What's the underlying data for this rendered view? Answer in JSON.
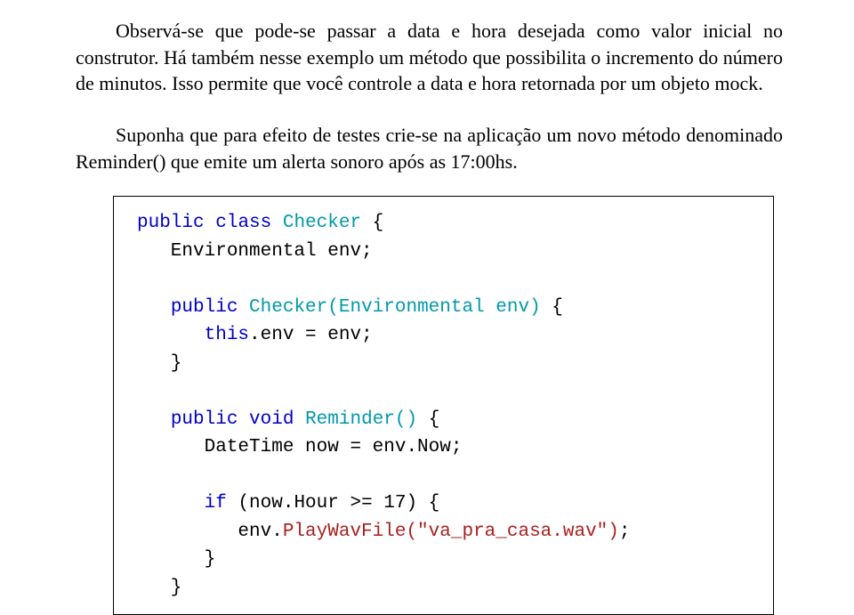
{
  "paragraphs": {
    "p1": "Observá-se que pode-se passar a data e hora desejada como valor inicial no construtor. Há também nesse exemplo um método que possibilita o incremento do número de minutos. Isso permite que você controle a data e hora retornada por um objeto mock.",
    "p2": "Suponha que para efeito de testes crie-se na aplicação um novo método denominado Reminder() que emite um alerta sonoro após as 17:00hs."
  },
  "code": {
    "line1_a": "public",
    "line1_b": " ",
    "line1_c": "class",
    "line1_d": " ",
    "line1_e": "Checker",
    "line1_f": " {",
    "line2": "   Environmental env;",
    "line3_a": "   ",
    "line3_b": "public",
    "line3_c": " ",
    "line3_d": "Checker(Environmental env)",
    "line3_e": " {",
    "line4_a": "      ",
    "line4_b": "this",
    "line4_c": ".env = env;",
    "line5": "   }",
    "line6_a": "   ",
    "line6_b": "public",
    "line6_c": " ",
    "line6_d": "void",
    "line6_e": " ",
    "line6_f": "Reminder()",
    "line6_g": " {",
    "line7": "      DateTime now = env.Now;",
    "line8_a": "      ",
    "line8_b": "if",
    "line8_c": " (now.Hour >= 17) {",
    "line9_a": "         env.",
    "line9_b": "PlayWavFile(\"va_pra_casa.wav\")",
    "line9_c": ";",
    "line10": "      }",
    "line11": "   }"
  }
}
